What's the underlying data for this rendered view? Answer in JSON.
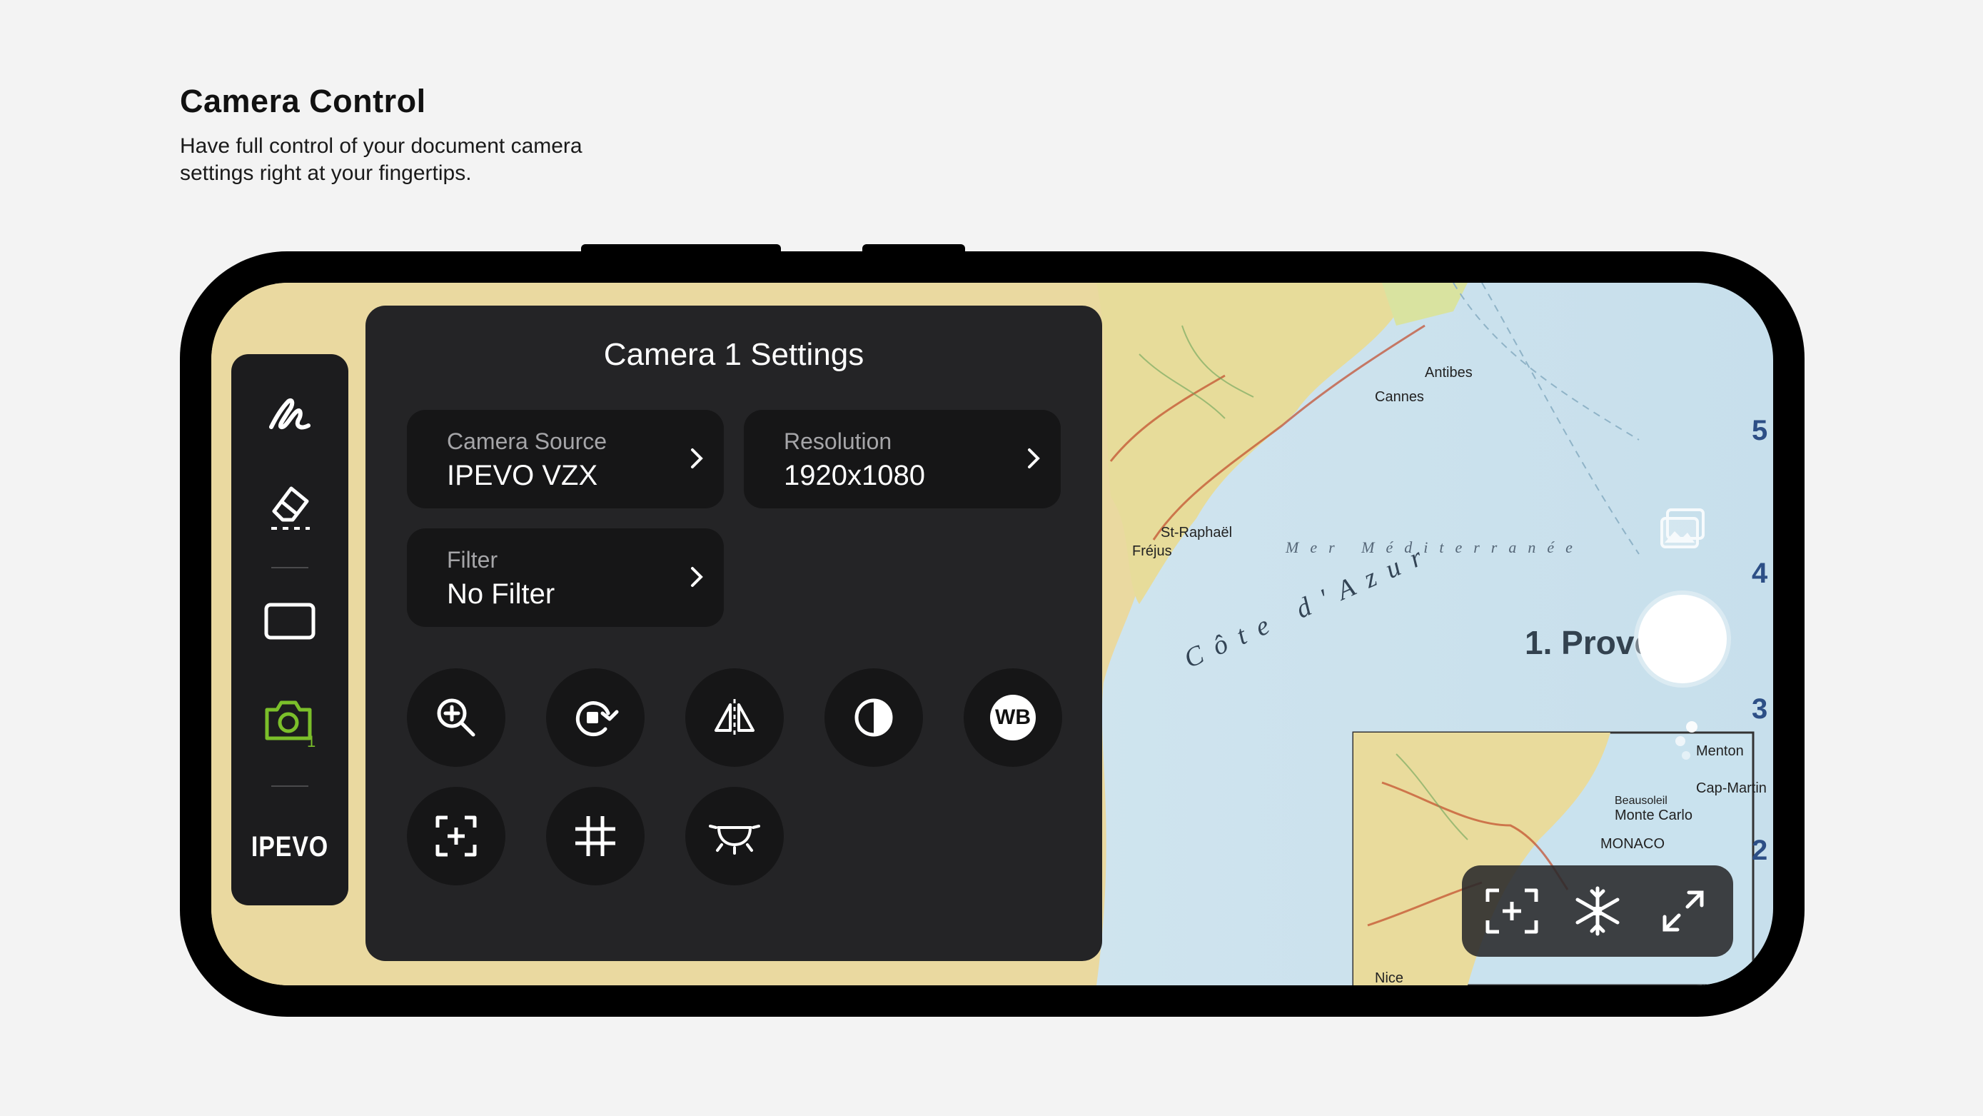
{
  "marketing": {
    "title": "Camera Control",
    "subtitle": "Have full control of your document camera settings right at your fingertips."
  },
  "map": {
    "region_label": "1. Proven",
    "sea_label": "Mer Méditerranée",
    "coast_label": "Côte d'Azur",
    "places": [
      "St-Raphaël",
      "Fréjus",
      "Cannes",
      "Antibes",
      "Menton",
      "Cap-Martin",
      "Monte Carlo",
      "MONACO",
      "Beausoleil",
      "Nice"
    ],
    "side_numbers": [
      "5",
      "4",
      "3",
      "2"
    ]
  },
  "toolbar": {
    "brand": "IPEVO",
    "items": [
      "pen-tool",
      "eraser-tool",
      "rectangle-view",
      "camera-1"
    ],
    "active_color": "#7bbf2a"
  },
  "panel": {
    "title": "Camera 1 Settings",
    "cards": [
      {
        "label": "Camera Source",
        "value": "IPEVO VZX"
      },
      {
        "label": "Resolution",
        "value": "1920x1080"
      },
      {
        "label": "Filter",
        "value": "No Filter"
      }
    ],
    "wb_label": "WB",
    "buttons": [
      "zoom-in",
      "rotate",
      "mirror",
      "contrast",
      "white-balance",
      "focus-area",
      "grid",
      "exposure"
    ]
  },
  "bottom_bar": {
    "buttons": [
      "focus",
      "freeze",
      "fullscreen"
    ]
  },
  "colors": {
    "panel_bg": "#242426",
    "card_bg": "#161617",
    "phone_frame": "#000000",
    "page_bg": "#f3f3f3"
  }
}
